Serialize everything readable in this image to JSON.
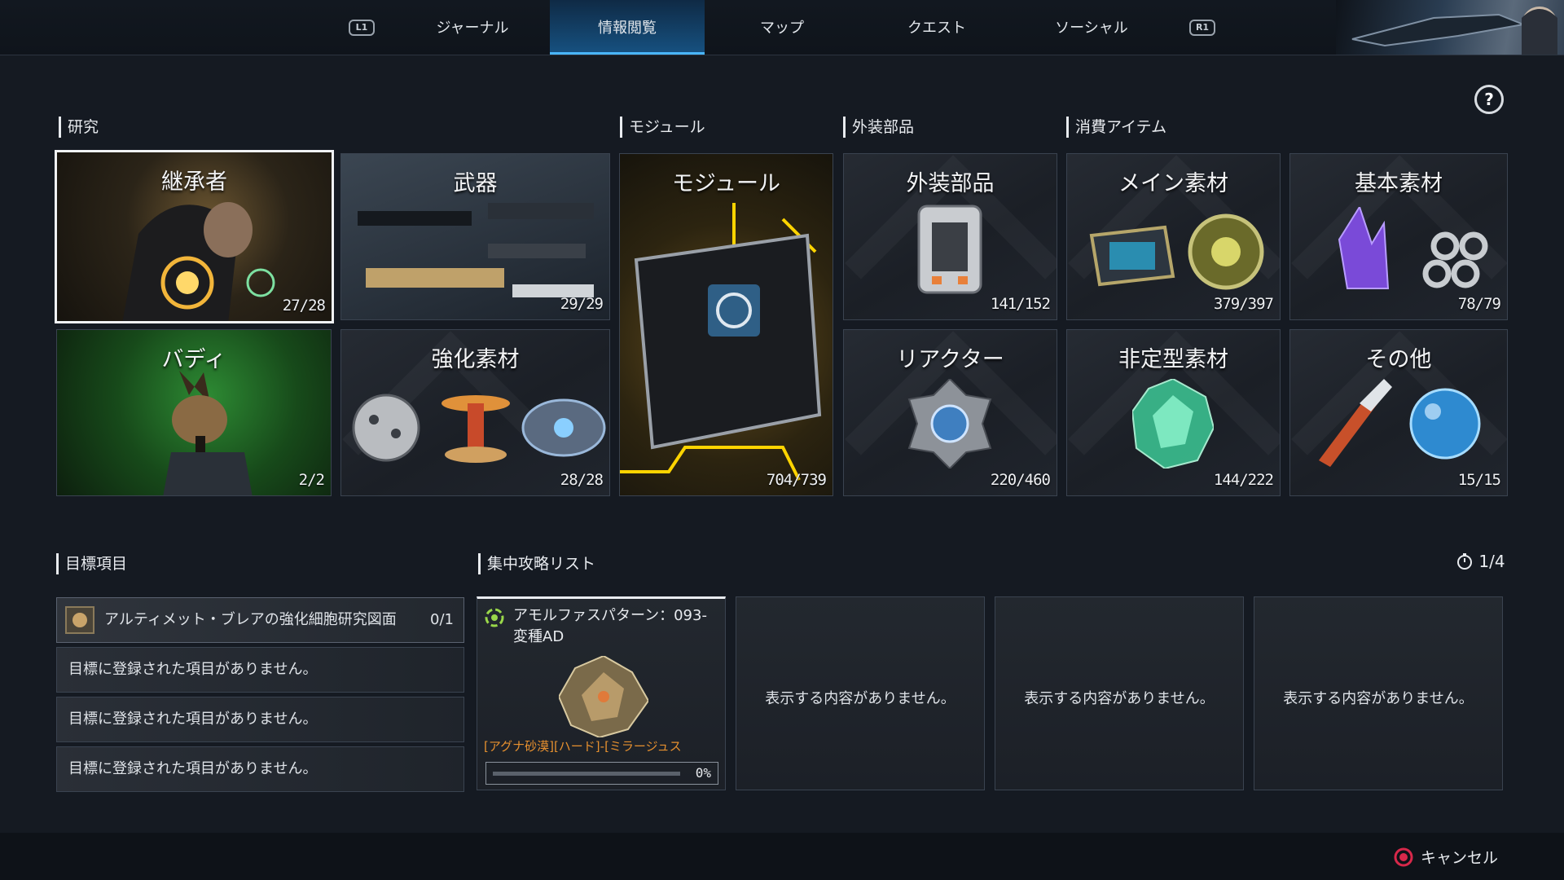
{
  "nav": {
    "l1": "L1",
    "r1": "R1",
    "tabs": [
      "ジャーナル",
      "情報閲覧",
      "マップ",
      "クエスト",
      "ソーシャル"
    ],
    "active_tab": "情報閲覧"
  },
  "help": "?",
  "sections": {
    "research": "研究",
    "module": "モジュール",
    "external": "外装部品",
    "consumable": "消費アイテム"
  },
  "tiles": {
    "descendant": {
      "title": "継承者",
      "count": "27/28"
    },
    "weapon": {
      "title": "武器",
      "count": "29/29"
    },
    "module": {
      "title": "モジュール",
      "count": "704/739"
    },
    "external": {
      "title": "外装部品",
      "count": "141/152"
    },
    "main_material": {
      "title": "メイン素材",
      "count": "379/397"
    },
    "basic_material": {
      "title": "基本素材",
      "count": "78/79"
    },
    "buddy": {
      "title": "バディ",
      "count": "2/2"
    },
    "enhance": {
      "title": "強化素材",
      "count": "28/28"
    },
    "reactor": {
      "title": "リアクター",
      "count": "220/460"
    },
    "amorphous": {
      "title": "非定型素材",
      "count": "144/222"
    },
    "other": {
      "title": "その他",
      "count": "15/15"
    }
  },
  "objectives": {
    "label": "目標項目",
    "first": {
      "name": "アルティメット・ブレアの強化細胞研究図面",
      "count": "0/1"
    },
    "empty_rows": [
      "目標に登録された項目がありません。",
      "目標に登録された項目がありません。",
      "目標に登録された項目がありません。"
    ]
  },
  "focus": {
    "label": "集中攻略リスト",
    "page": "1/4",
    "first_card": {
      "title": "アモルファスパターン：093-変種AD",
      "location": "[アグナ砂漠][ハード]-[ミラージュス",
      "progress_label": "0%",
      "progress": 0
    },
    "empty_cards": [
      "表示する内容がありません。",
      "表示する内容がありません。",
      "表示する内容がありません。"
    ]
  },
  "footer": {
    "cancel": "キャンセル"
  },
  "colors": {
    "accent": "#4ab6ff",
    "location_text": "#e6902f",
    "cancel_icon": "#d8284a"
  }
}
